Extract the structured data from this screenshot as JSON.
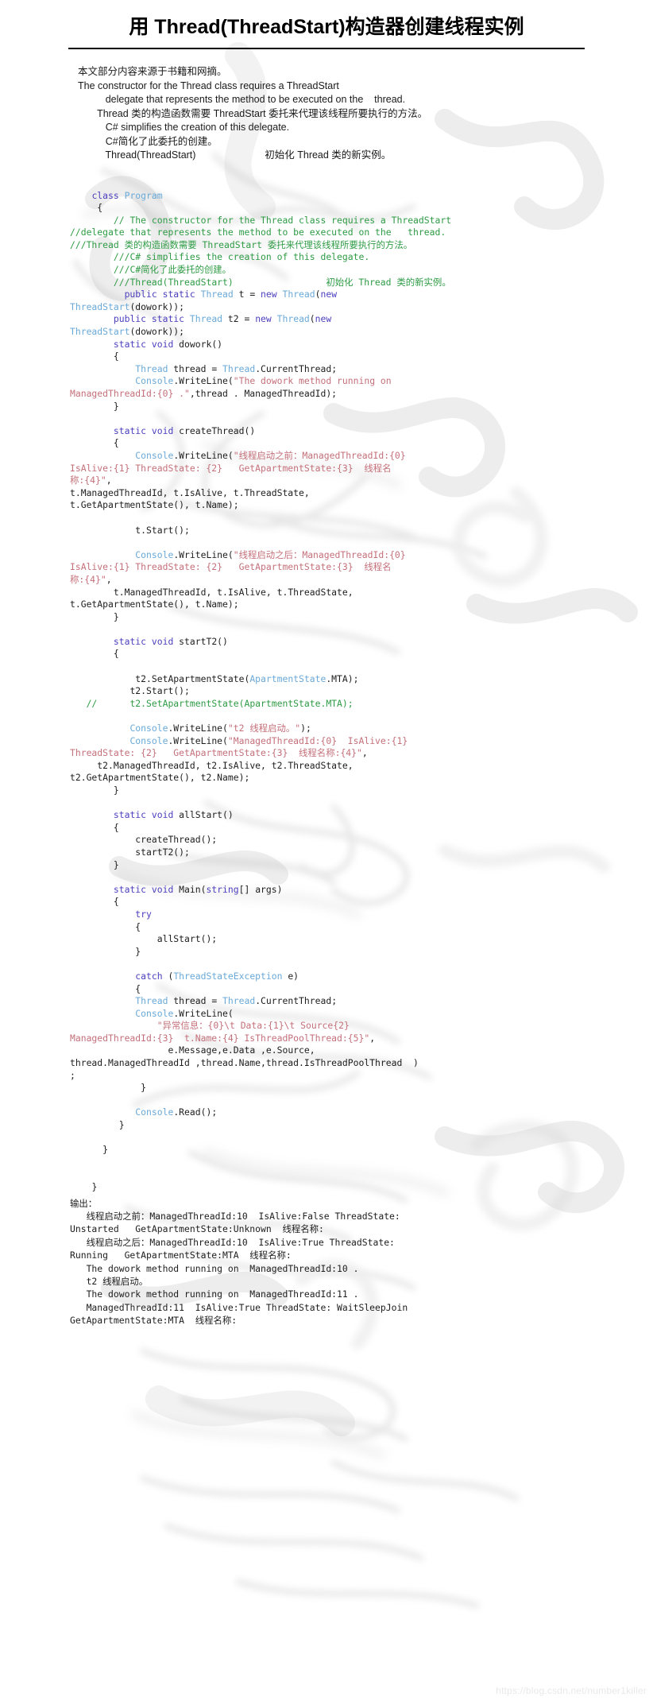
{
  "document": {
    "title": "用 Thread(ThreadStart)构造器创建线程实例",
    "watermark_url": "https://blog.csdn.net/number1killer",
    "colors": {
      "keyword": "#4b3fbe",
      "type": "#6aa9d8",
      "comment": "#2e9b45",
      "string": "#c4707a",
      "plain": "#1d1d1d",
      "background": "#ffffff"
    }
  },
  "intro": {
    "lines": [
      "本文部分内容来源于书籍和网摘。",
      "The constructor for the Thread class requires a ThreadStart",
      "          delegate that represents the method to be executed on the    thread.",
      "       Thread 类的构造函数需要 ThreadStart 委托来代理该线程所要执行的方法。",
      "          C# simplifies the creation of this delegate.",
      "          C#简化了此委托的创建。",
      "          Thread(ThreadStart)                         初始化 Thread 类的新实例。"
    ]
  },
  "code": {
    "language": "csharp",
    "lines": [
      [
        {
          "t": "    ",
          "c": "pln"
        },
        {
          "t": "class ",
          "c": "kw"
        },
        {
          "t": "Program",
          "c": "typ"
        }
      ],
      [
        {
          "t": "     {",
          "c": "pln"
        }
      ],
      [
        {
          "t": "        // The constructor for the Thread class requires a ThreadStart",
          "c": "cmt"
        }
      ],
      [
        {
          "t": "//delegate that represents the method to be executed on the   thread.",
          "c": "cmt"
        }
      ],
      [
        {
          "t": "///Thread 类的构造函数需要 ThreadStart 委托来代理该线程所要执行的方法。",
          "c": "cmt"
        }
      ],
      [
        {
          "t": "        ///C# simplifies the creation of this delegate.",
          "c": "cmt"
        }
      ],
      [
        {
          "t": "        ///C#简化了此委托的创建。",
          "c": "cmt"
        }
      ],
      [
        {
          "t": "        ///Thread(ThreadStart)                 初始化 Thread 类的新实例。",
          "c": "cmt"
        }
      ],
      [
        {
          "t": "          ",
          "c": "pln"
        },
        {
          "t": "public static ",
          "c": "kw"
        },
        {
          "t": "Thread",
          "c": "typ"
        },
        {
          "t": " t = ",
          "c": "pln"
        },
        {
          "t": "new ",
          "c": "kw"
        },
        {
          "t": "Thread",
          "c": "typ"
        },
        {
          "t": "(",
          "c": "pln"
        },
        {
          "t": "new",
          "c": "kw"
        }
      ],
      [
        {
          "t": "ThreadStart",
          "c": "typ"
        },
        {
          "t": "(dowork));",
          "c": "pln"
        }
      ],
      [
        {
          "t": "        ",
          "c": "pln"
        },
        {
          "t": "public static ",
          "c": "kw"
        },
        {
          "t": "Thread",
          "c": "typ"
        },
        {
          "t": " t2 = ",
          "c": "pln"
        },
        {
          "t": "new ",
          "c": "kw"
        },
        {
          "t": "Thread",
          "c": "typ"
        },
        {
          "t": "(",
          "c": "pln"
        },
        {
          "t": "new",
          "c": "kw"
        }
      ],
      [
        {
          "t": "ThreadStart",
          "c": "typ"
        },
        {
          "t": "(dowork));",
          "c": "pln"
        }
      ],
      [
        {
          "t": "        ",
          "c": "pln"
        },
        {
          "t": "static void ",
          "c": "kw"
        },
        {
          "t": "dowork()",
          "c": "pln"
        }
      ],
      [
        {
          "t": "        {",
          "c": "pln"
        }
      ],
      [
        {
          "t": "            ",
          "c": "pln"
        },
        {
          "t": "Thread",
          "c": "typ"
        },
        {
          "t": " thread = ",
          "c": "pln"
        },
        {
          "t": "Thread",
          "c": "typ"
        },
        {
          "t": ".CurrentThread;",
          "c": "pln"
        }
      ],
      [
        {
          "t": "            ",
          "c": "pln"
        },
        {
          "t": "Console",
          "c": "typ"
        },
        {
          "t": ".WriteLine(",
          "c": "pln"
        },
        {
          "t": "\"The dowork method running on",
          "c": "str"
        }
      ],
      [
        {
          "t": "ManagedThreadId:{0} .\"",
          "c": "str"
        },
        {
          "t": ",thread . ManagedThreadId);",
          "c": "pln"
        }
      ],
      [
        {
          "t": "        }",
          "c": "pln"
        }
      ],
      [
        {
          "t": "",
          "c": "pln"
        }
      ],
      [
        {
          "t": "        ",
          "c": "pln"
        },
        {
          "t": "static void ",
          "c": "kw"
        },
        {
          "t": "createThread()",
          "c": "pln"
        }
      ],
      [
        {
          "t": "        {",
          "c": "pln"
        }
      ],
      [
        {
          "t": "            ",
          "c": "pln"
        },
        {
          "t": "Console",
          "c": "typ"
        },
        {
          "t": ".WriteLine(",
          "c": "pln"
        },
        {
          "t": "\"线程启动之前：ManagedThreadId:{0}",
          "c": "str"
        }
      ],
      [
        {
          "t": "IsAlive:{1} ThreadState: {2}   GetApartmentState:{3}  线程名",
          "c": "str"
        }
      ],
      [
        {
          "t": "称:{4}\"",
          "c": "str"
        },
        {
          "t": ",",
          "c": "pln"
        }
      ],
      [
        {
          "t": "t.ManagedThreadId, t.IsAlive, t.ThreadState,",
          "c": "pln"
        }
      ],
      [
        {
          "t": "t.GetApartmentState(), t.Name);",
          "c": "pln"
        }
      ],
      [
        {
          "t": "",
          "c": "pln"
        }
      ],
      [
        {
          "t": "            t.Start();",
          "c": "pln"
        }
      ],
      [
        {
          "t": "",
          "c": "pln"
        }
      ],
      [
        {
          "t": "            ",
          "c": "pln"
        },
        {
          "t": "Console",
          "c": "typ"
        },
        {
          "t": ".WriteLine(",
          "c": "pln"
        },
        {
          "t": "\"线程启动之后：ManagedThreadId:{0}",
          "c": "str"
        }
      ],
      [
        {
          "t": "IsAlive:{1} ThreadState: {2}   GetApartmentState:{3}  线程名",
          "c": "str"
        }
      ],
      [
        {
          "t": "称:{4}\"",
          "c": "str"
        },
        {
          "t": ",",
          "c": "pln"
        }
      ],
      [
        {
          "t": "        t.ManagedThreadId, t.IsAlive, t.ThreadState,",
          "c": "pln"
        }
      ],
      [
        {
          "t": "t.GetApartmentState(), t.Name);",
          "c": "pln"
        }
      ],
      [
        {
          "t": "        }",
          "c": "pln"
        }
      ],
      [
        {
          "t": "",
          "c": "pln"
        }
      ],
      [
        {
          "t": "        ",
          "c": "pln"
        },
        {
          "t": "static void ",
          "c": "kw"
        },
        {
          "t": "startT2()",
          "c": "pln"
        }
      ],
      [
        {
          "t": "        {",
          "c": "pln"
        }
      ],
      [
        {
          "t": "",
          "c": "pln"
        }
      ],
      [
        {
          "t": "            t2.SetApartmentState(",
          "c": "pln"
        },
        {
          "t": "ApartmentState",
          "c": "typ"
        },
        {
          "t": ".MTA);",
          "c": "pln"
        }
      ],
      [
        {
          "t": "           t2.Start();",
          "c": "pln"
        }
      ],
      [
        {
          "t": "   //    ",
          "c": "cmt"
        },
        {
          "t": "  t2.SetApartmentState(ApartmentState.MTA);",
          "c": "cmt"
        }
      ],
      [
        {
          "t": "",
          "c": "pln"
        }
      ],
      [
        {
          "t": "           ",
          "c": "pln"
        },
        {
          "t": "Console",
          "c": "typ"
        },
        {
          "t": ".WriteLine(",
          "c": "pln"
        },
        {
          "t": "\"t2 线程启动。\"",
          "c": "str"
        },
        {
          "t": ");",
          "c": "pln"
        }
      ],
      [
        {
          "t": "           ",
          "c": "pln"
        },
        {
          "t": "Console",
          "c": "typ"
        },
        {
          "t": ".WriteLine(",
          "c": "pln"
        },
        {
          "t": "\"ManagedThreadId:{0}  IsAlive:{1}",
          "c": "str"
        }
      ],
      [
        {
          "t": "ThreadState: {2}   GetApartmentState:{3}  线程名称:{4}\"",
          "c": "str"
        },
        {
          "t": ",",
          "c": "pln"
        }
      ],
      [
        {
          "t": "     t2.ManagedThreadId, t2.IsAlive, t2.ThreadState,",
          "c": "pln"
        }
      ],
      [
        {
          "t": "t2.GetApartmentState(), t2.Name);",
          "c": "pln"
        }
      ],
      [
        {
          "t": "        }",
          "c": "pln"
        }
      ],
      [
        {
          "t": "",
          "c": "pln"
        }
      ],
      [
        {
          "t": "        ",
          "c": "pln"
        },
        {
          "t": "static void ",
          "c": "kw"
        },
        {
          "t": "allStart()",
          "c": "pln"
        }
      ],
      [
        {
          "t": "        {",
          "c": "pln"
        }
      ],
      [
        {
          "t": "            createThread();",
          "c": "pln"
        }
      ],
      [
        {
          "t": "            startT2();",
          "c": "pln"
        }
      ],
      [
        {
          "t": "        }",
          "c": "pln"
        }
      ],
      [
        {
          "t": "",
          "c": "pln"
        }
      ],
      [
        {
          "t": "        ",
          "c": "pln"
        },
        {
          "t": "static void ",
          "c": "kw"
        },
        {
          "t": "Main(",
          "c": "pln"
        },
        {
          "t": "string",
          "c": "kw"
        },
        {
          "t": "[] args)",
          "c": "pln"
        }
      ],
      [
        {
          "t": "        {",
          "c": "pln"
        }
      ],
      [
        {
          "t": "            ",
          "c": "pln"
        },
        {
          "t": "try",
          "c": "kw"
        }
      ],
      [
        {
          "t": "            {",
          "c": "pln"
        }
      ],
      [
        {
          "t": "                allStart();",
          "c": "pln"
        }
      ],
      [
        {
          "t": "            }",
          "c": "pln"
        }
      ],
      [
        {
          "t": "",
          "c": "pln"
        }
      ],
      [
        {
          "t": "            ",
          "c": "pln"
        },
        {
          "t": "catch ",
          "c": "kw"
        },
        {
          "t": "(",
          "c": "pln"
        },
        {
          "t": "ThreadStateException",
          "c": "typ"
        },
        {
          "t": " e)",
          "c": "pln"
        }
      ],
      [
        {
          "t": "            {",
          "c": "pln"
        }
      ],
      [
        {
          "t": "            ",
          "c": "pln"
        },
        {
          "t": "Thread",
          "c": "typ"
        },
        {
          "t": " thread = ",
          "c": "pln"
        },
        {
          "t": "Thread",
          "c": "typ"
        },
        {
          "t": ".CurrentThread;",
          "c": "pln"
        }
      ],
      [
        {
          "t": "            ",
          "c": "pln"
        },
        {
          "t": "Console",
          "c": "typ"
        },
        {
          "t": ".WriteLine(",
          "c": "pln"
        }
      ],
      [
        {
          "t": "                ",
          "c": "pln"
        },
        {
          "t": "\"异常信息：{0}\\t Data:{1}\\t Source{2}",
          "c": "str"
        }
      ],
      [
        {
          "t": "ManagedThreadId:{3}  t.Name:{4} IsThreadPoolThread:{5}\"",
          "c": "str"
        },
        {
          "t": ",",
          "c": "pln"
        }
      ],
      [
        {
          "t": "                  e.Message,e.Data ,e.Source,",
          "c": "pln"
        }
      ],
      [
        {
          "t": "thread.ManagedThreadId ,thread.Name,thread.IsThreadPoolThread  )",
          "c": "pln"
        }
      ],
      [
        {
          "t": ";",
          "c": "pln"
        }
      ],
      [
        {
          "t": "             }",
          "c": "pln"
        }
      ],
      [
        {
          "t": "",
          "c": "pln"
        }
      ],
      [
        {
          "t": "            ",
          "c": "pln"
        },
        {
          "t": "Console",
          "c": "typ"
        },
        {
          "t": ".Read();",
          "c": "pln"
        }
      ],
      [
        {
          "t": "         }",
          "c": "pln"
        }
      ],
      [
        {
          "t": "",
          "c": "pln"
        }
      ],
      [
        {
          "t": "      }",
          "c": "pln"
        }
      ],
      [
        {
          "t": "",
          "c": "pln"
        }
      ],
      [
        {
          "t": "",
          "c": "pln"
        }
      ],
      [
        {
          "t": "    }",
          "c": "pln"
        }
      ]
    ]
  },
  "output": {
    "label": "输出：",
    "lines": [
      "   线程启动之前：ManagedThreadId:10  IsAlive:False ThreadState:",
      "Unstarted   GetApartmentState:Unknown  线程名称:",
      "   线程启动之后：ManagedThreadId:10  IsAlive:True ThreadState:",
      "Running   GetApartmentState:MTA  线程名称:",
      "   The dowork method running on  ManagedThreadId:10 .",
      "   t2 线程启动。",
      "   The dowork method running on  ManagedThreadId:11 .",
      "   ManagedThreadId:11  IsAlive:True ThreadState: WaitSleepJoin",
      "GetApartmentState:MTA  线程名称:"
    ]
  }
}
